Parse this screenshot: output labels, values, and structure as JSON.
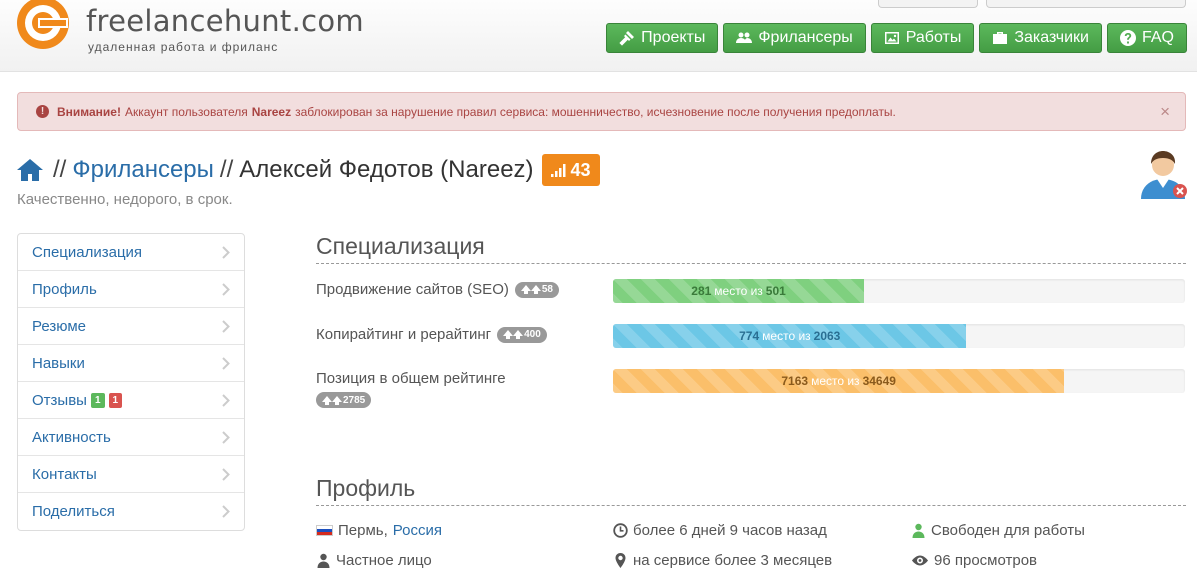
{
  "header": {
    "brand": "freelancehunt.com",
    "tagline": "удаленная работа и фриланс",
    "nav": [
      {
        "label": "Проекты",
        "icon": "gavel-icon"
      },
      {
        "label": "Фрилансеры",
        "icon": "users-icon"
      },
      {
        "label": "Работы",
        "icon": "picture-icon"
      },
      {
        "label": "Заказчики",
        "icon": "briefcase-icon"
      },
      {
        "label": "FAQ",
        "icon": "question-icon"
      }
    ]
  },
  "alert": {
    "prefix": "Внимание!",
    "text_before": "Аккаунт пользователя",
    "username": "Nareez",
    "text_after": "заблокирован за нарушение правил сервиса: мошенничество, исчезновение после получения предоплаты.",
    "close": "×"
  },
  "breadcrumb": {
    "sep": "//",
    "section": "Фрилансеры",
    "person": "Алексей Федотов (Nareez)",
    "rating": "43"
  },
  "subtitle": "Качественно, недорого, в срок.",
  "sidebar": {
    "items": [
      {
        "label": "Специализация"
      },
      {
        "label": "Профиль"
      },
      {
        "label": "Резюме"
      },
      {
        "label": "Навыки"
      },
      {
        "label": "Отзывы",
        "positive": "1",
        "negative": "1"
      },
      {
        "label": "Активность"
      },
      {
        "label": "Контакты"
      },
      {
        "label": "Поделиться"
      }
    ]
  },
  "specialization": {
    "title": "Специализация",
    "middle_text": "место из",
    "rows": [
      {
        "label": "Продвижение сайтов (SEO)",
        "up": "58",
        "place": "281",
        "total": "501",
        "fill_fraction": 0.439,
        "color": "#7fd07f"
      },
      {
        "label": "Копирайтинг и рерайтинг",
        "up": "400",
        "place": "774",
        "total": "2063",
        "fill_fraction": 0.618,
        "color": "#6cc7e6"
      },
      {
        "label": "Позиция в общем рейтинге",
        "up": "2785",
        "place": "7163",
        "total": "34649",
        "fill_fraction": 0.789,
        "color": "#fbbf6a"
      }
    ]
  },
  "profile": {
    "title": "Профиль",
    "city": "Пермь,",
    "country": "Россия",
    "person_type": "Частное лицо",
    "last_seen": "более 6 дней 9 часов назад",
    "on_service": "на сервисе более 3 месяцев",
    "status": "Свободен для работы",
    "views": "96 просмотров"
  }
}
